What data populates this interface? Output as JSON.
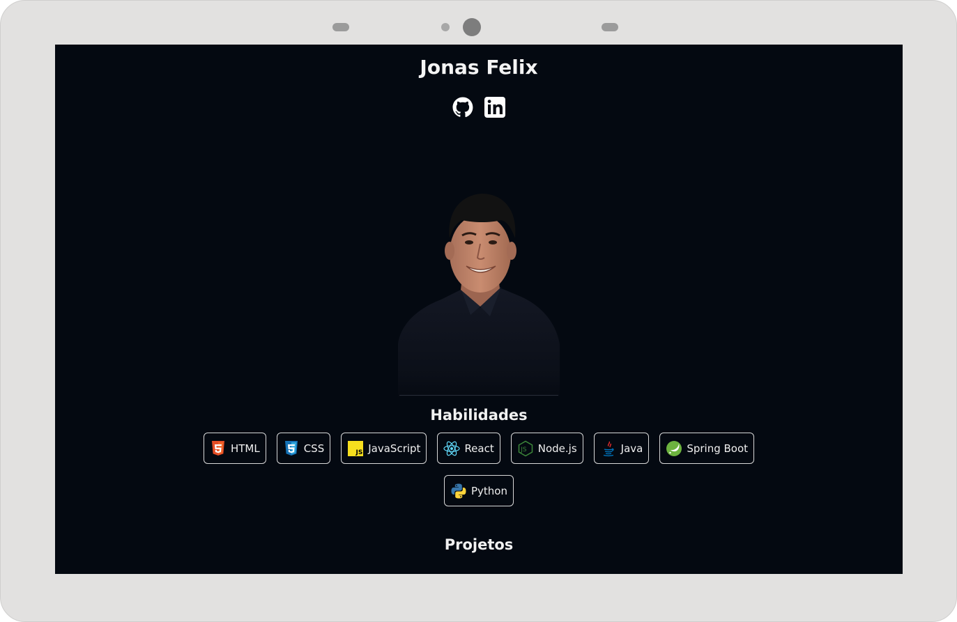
{
  "profile": {
    "name": "Jonas Felix",
    "socials": [
      {
        "icon": "github-icon",
        "label": "GitHub"
      },
      {
        "icon": "linkedin-icon",
        "label": "LinkedIn"
      }
    ]
  },
  "skills": {
    "title": "Habilidades",
    "items": [
      {
        "label": "HTML",
        "icon": "html5-icon"
      },
      {
        "label": "CSS",
        "icon": "css3-icon"
      },
      {
        "label": "JavaScript",
        "icon": "javascript-icon"
      },
      {
        "label": "React",
        "icon": "react-icon"
      },
      {
        "label": "Node.js",
        "icon": "nodejs-icon"
      },
      {
        "label": "Java",
        "icon": "java-icon"
      },
      {
        "label": "Spring Boot",
        "icon": "spring-boot-icon"
      },
      {
        "label": "Python",
        "icon": "python-icon"
      }
    ]
  },
  "projects": {
    "title": "Projetos"
  },
  "colors": {
    "screen_background": "#040911",
    "device_frame": "#e2e1e0",
    "text": "#f4f4f4",
    "chip_border": "#d9d9d9"
  }
}
